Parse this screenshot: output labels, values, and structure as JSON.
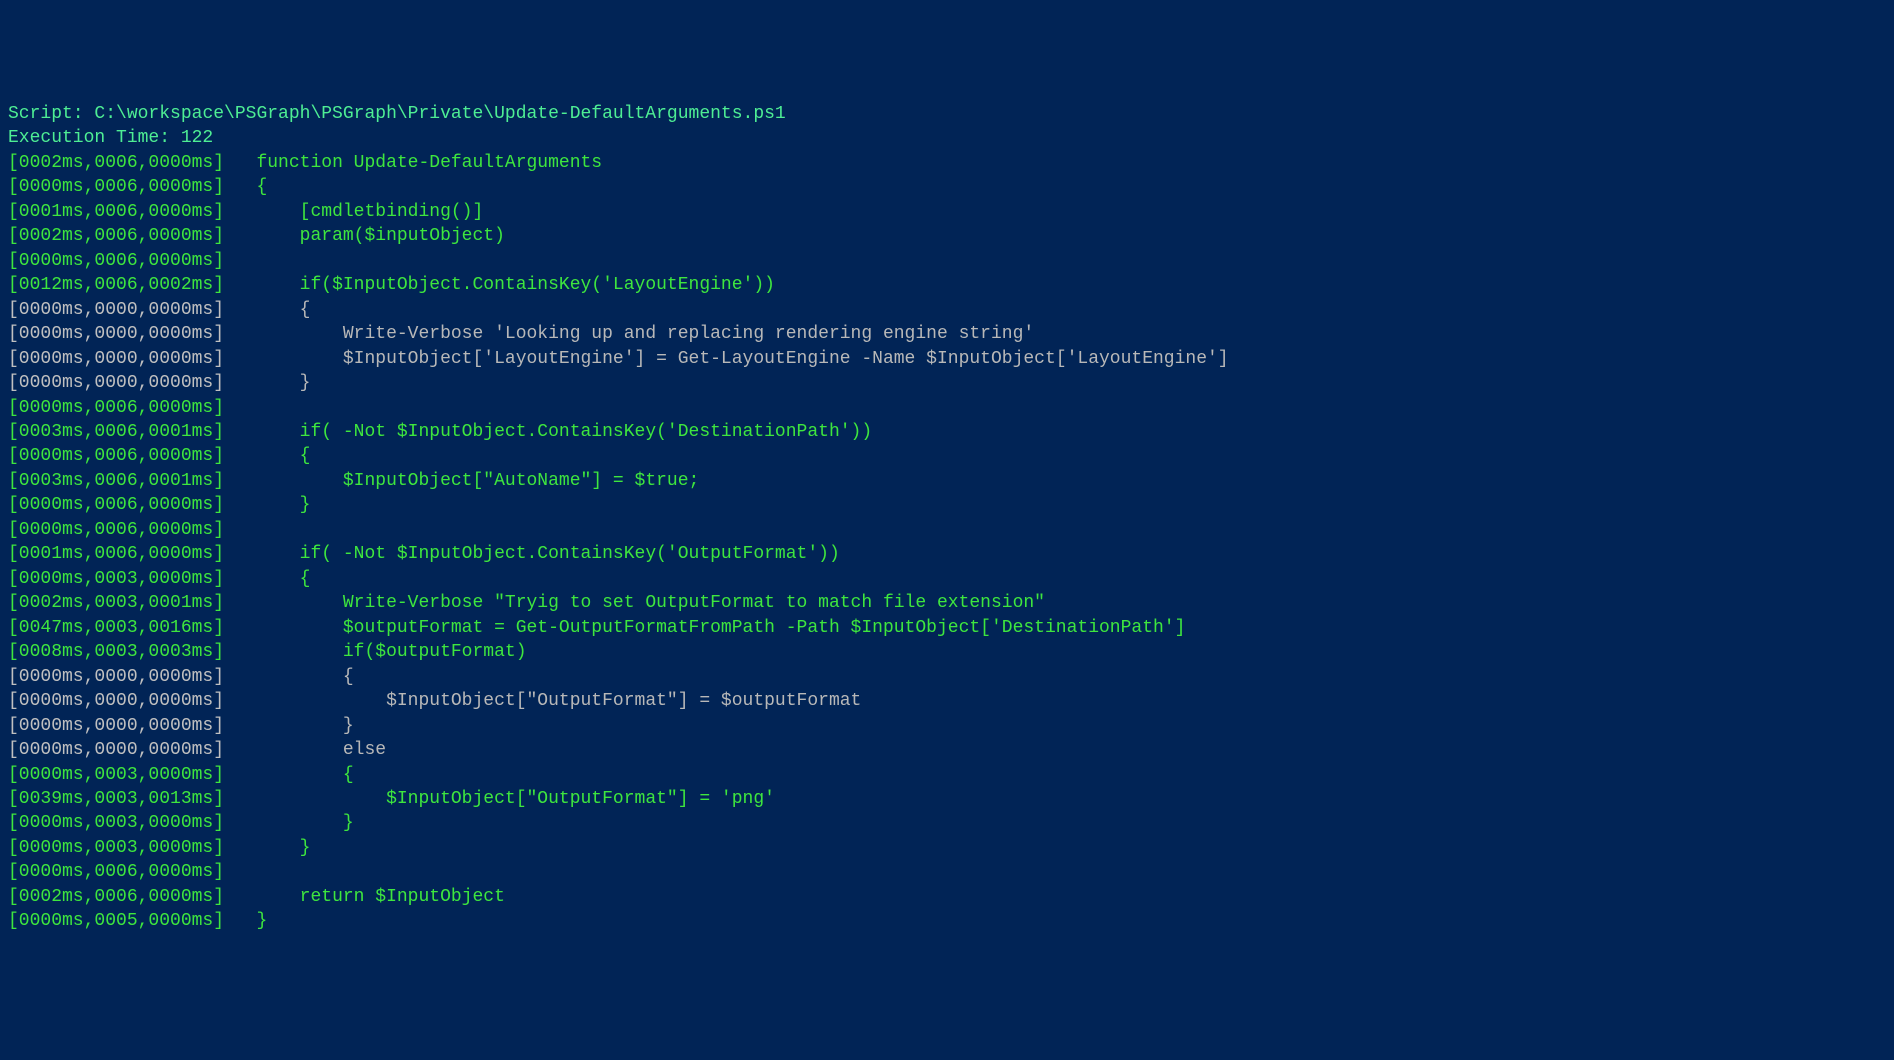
{
  "header": {
    "script_label": "Script: ",
    "script_path": "C:\\workspace\\PSGraph\\PSGraph\\Private\\Update-DefaultArguments.ps1",
    "exec_label": "Execution Time: ",
    "exec_time": "122"
  },
  "lines": [
    {
      "timing": "[0002ms,0006,0000ms]",
      "tclass": "timing-bright",
      "code": "   function Update-DefaultArguments",
      "cclass": "code-bright"
    },
    {
      "timing": "[0000ms,0006,0000ms]",
      "tclass": "timing-bright",
      "code": "   {",
      "cclass": "code-bright"
    },
    {
      "timing": "[0001ms,0006,0000ms]",
      "tclass": "timing-bright",
      "code": "       [cmdletbinding()]",
      "cclass": "code-bright"
    },
    {
      "timing": "[0002ms,0006,0000ms]",
      "tclass": "timing-bright",
      "code": "       param($inputObject)",
      "cclass": "code-bright"
    },
    {
      "timing": "[0000ms,0006,0000ms]",
      "tclass": "timing-bright",
      "code": "   ",
      "cclass": "code-bright"
    },
    {
      "timing": "[0012ms,0006,0002ms]",
      "tclass": "timing-bright",
      "code": "       if($InputObject.ContainsKey('LayoutEngine'))",
      "cclass": "code-bright"
    },
    {
      "timing": "[0000ms,0000,0000ms]",
      "tclass": "timing-dim",
      "code": "       {",
      "cclass": "code-dim"
    },
    {
      "timing": "[0000ms,0000,0000ms]",
      "tclass": "timing-dim",
      "code": "           Write-Verbose 'Looking up and replacing rendering engine string'",
      "cclass": "code-dim"
    },
    {
      "timing": "[0000ms,0000,0000ms]",
      "tclass": "timing-dim",
      "code": "           $InputObject['LayoutEngine'] = Get-LayoutEngine -Name $InputObject['LayoutEngine']",
      "cclass": "code-dim"
    },
    {
      "timing": "[0000ms,0000,0000ms]",
      "tclass": "timing-dim",
      "code": "       }",
      "cclass": "code-dim"
    },
    {
      "timing": "[0000ms,0006,0000ms]",
      "tclass": "timing-bright",
      "code": "   ",
      "cclass": "code-bright"
    },
    {
      "timing": "[0003ms,0006,0001ms]",
      "tclass": "timing-bright",
      "code": "       if( -Not $InputObject.ContainsKey('DestinationPath'))",
      "cclass": "code-bright"
    },
    {
      "timing": "[0000ms,0006,0000ms]",
      "tclass": "timing-bright",
      "code": "       {",
      "cclass": "code-bright"
    },
    {
      "timing": "[0003ms,0006,0001ms]",
      "tclass": "timing-bright",
      "code": "           $InputObject[\"AutoName\"] = $true;",
      "cclass": "code-bright"
    },
    {
      "timing": "[0000ms,0006,0000ms]",
      "tclass": "timing-bright",
      "code": "       }",
      "cclass": "code-bright"
    },
    {
      "timing": "[0000ms,0006,0000ms]",
      "tclass": "timing-bright",
      "code": "   ",
      "cclass": "code-bright"
    },
    {
      "timing": "[0001ms,0006,0000ms]",
      "tclass": "timing-bright",
      "code": "       if( -Not $InputObject.ContainsKey('OutputFormat'))",
      "cclass": "code-bright"
    },
    {
      "timing": "[0000ms,0003,0000ms]",
      "tclass": "timing-bright",
      "code": "       {",
      "cclass": "code-bright"
    },
    {
      "timing": "[0002ms,0003,0001ms]",
      "tclass": "timing-bright",
      "code": "           Write-Verbose \"Tryig to set OutputFormat to match file extension\"",
      "cclass": "code-bright"
    },
    {
      "timing": "[0047ms,0003,0016ms]",
      "tclass": "timing-bright",
      "code": "           $outputFormat = Get-OutputFormatFromPath -Path $InputObject['DestinationPath']",
      "cclass": "code-bright"
    },
    {
      "timing": "[0008ms,0003,0003ms]",
      "tclass": "timing-bright",
      "code": "           if($outputFormat)",
      "cclass": "code-bright"
    },
    {
      "timing": "[0000ms,0000,0000ms]",
      "tclass": "timing-dim",
      "code": "           {",
      "cclass": "code-dim"
    },
    {
      "timing": "[0000ms,0000,0000ms]",
      "tclass": "timing-dim",
      "code": "               $InputObject[\"OutputFormat\"] = $outputFormat",
      "cclass": "code-dim"
    },
    {
      "timing": "[0000ms,0000,0000ms]",
      "tclass": "timing-dim",
      "code": "           }",
      "cclass": "code-dim"
    },
    {
      "timing": "[0000ms,0000,0000ms]",
      "tclass": "timing-dim",
      "code": "           else",
      "cclass": "code-dim"
    },
    {
      "timing": "[0000ms,0003,0000ms]",
      "tclass": "timing-bright",
      "code": "           {",
      "cclass": "code-bright"
    },
    {
      "timing": "[0039ms,0003,0013ms]",
      "tclass": "timing-bright",
      "code": "               $InputObject[\"OutputFormat\"] = 'png'",
      "cclass": "code-bright"
    },
    {
      "timing": "[0000ms,0003,0000ms]",
      "tclass": "timing-bright",
      "code": "           }",
      "cclass": "code-bright"
    },
    {
      "timing": "[0000ms,0003,0000ms]",
      "tclass": "timing-bright",
      "code": "       }",
      "cclass": "code-bright"
    },
    {
      "timing": "[0000ms,0006,0000ms]",
      "tclass": "timing-bright",
      "code": "   ",
      "cclass": "code-bright"
    },
    {
      "timing": "[0002ms,0006,0000ms]",
      "tclass": "timing-bright",
      "code": "       return $InputObject",
      "cclass": "code-bright"
    },
    {
      "timing": "[0000ms,0005,0000ms]",
      "tclass": "timing-bright",
      "code": "   }",
      "cclass": "code-bright"
    }
  ]
}
